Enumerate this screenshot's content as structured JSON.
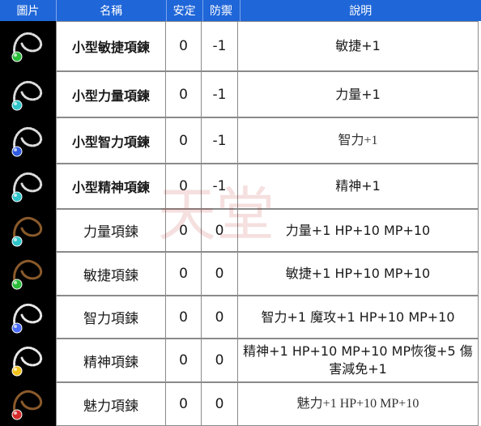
{
  "header": {
    "image": "圖片",
    "name": "名稱",
    "safe": "安定",
    "defense": "防禦",
    "desc": "說明"
  },
  "rows": [
    {
      "icon": "necklace-green-gem-icon",
      "name": "小型敏捷項鍊",
      "safe": "0",
      "defense": "-1",
      "desc": "敏捷+1"
    },
    {
      "icon": "necklace-cyan-gem-icon",
      "name": "小型力量項鍊",
      "safe": "0",
      "defense": "-1",
      "desc": "力量+1"
    },
    {
      "icon": "necklace-blue-gem-icon",
      "name": "小型智力項鍊",
      "safe": "0",
      "defense": "-1",
      "desc": "智力+1"
    },
    {
      "icon": "necklace-cyan-gem-icon",
      "name": "小型精神項鍊",
      "safe": "0",
      "defense": "-1",
      "desc": "精神+1"
    },
    {
      "icon": "leather-necklace-cyan-gem-icon",
      "name": "力量項鍊",
      "safe": "0",
      "defense": "0",
      "desc": "力量+1 HP+10 MP+10"
    },
    {
      "icon": "leather-necklace-green-gem-icon",
      "name": "敏捷項鍊",
      "safe": "0",
      "defense": "0",
      "desc": "敏捷+1 HP+10 MP+10"
    },
    {
      "icon": "chain-necklace-blue-star-icon",
      "name": "智力項鍊",
      "safe": "0",
      "defense": "0",
      "desc": "智力+1 魔攻+1 HP+10 MP+10"
    },
    {
      "icon": "chain-necklace-yellow-gem-icon",
      "name": "精神項鍊",
      "safe": "0",
      "defense": "0",
      "desc": "精神+1 HP+10 MP+10 MP恢復+5 傷害減免+1"
    },
    {
      "icon": "leather-necklace-red-gem-icon",
      "name": "魅力項鍊",
      "safe": "0",
      "defense": "0",
      "desc": "魅力+1 HP+10 MP+10"
    }
  ],
  "colors": {
    "header_bg": "#1f66d8",
    "header_text": "#ffffff",
    "image_bg": "#000000",
    "border": "#8a8a8a"
  }
}
